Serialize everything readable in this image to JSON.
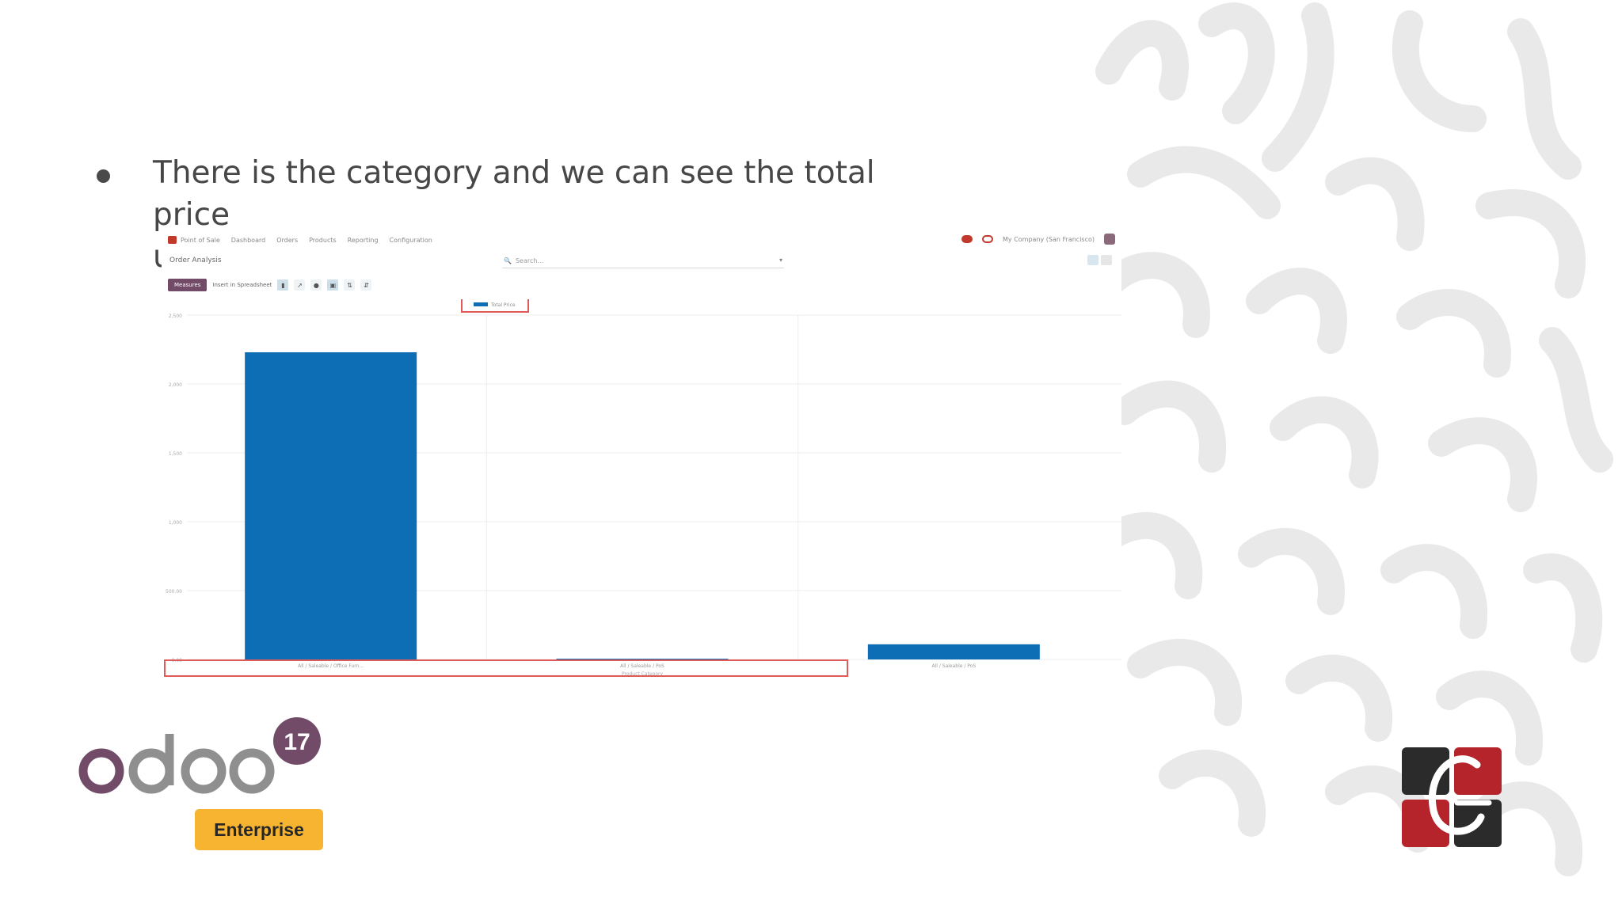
{
  "slide": {
    "bullet_text": "There is the category and we can see the total price\nunder the each category."
  },
  "app": {
    "menu": [
      "Point of Sale",
      "Dashboard",
      "Orders",
      "Products",
      "Reporting",
      "Configuration"
    ],
    "company": "My Company (San Francisco)",
    "breadcrumb": "Order Analysis",
    "search_placeholder": "Search...",
    "measures_label": "Measures",
    "insert_label": "Insert in Spreadsheet"
  },
  "chart_data": {
    "type": "bar",
    "series": [
      {
        "name": "Total Price",
        "values": [
          2230,
          0,
          110
        ]
      }
    ],
    "categories": [
      "All / Saleable / Office Furn...",
      "All / Saleable / PoS",
      "All / Saleable / PoS"
    ],
    "xlabel": "Product Category",
    "ylabel": "",
    "yticks": [
      "0.00",
      "500.00",
      "1,000",
      "1,500",
      "2,000",
      "2,500"
    ],
    "ylim": [
      0,
      2500
    ],
    "legend_position": "top-center",
    "colors": {
      "bar": "#0d6eb6",
      "highlight": "#e05a5a"
    }
  },
  "branding": {
    "odoo_text": "odoo",
    "version": "17",
    "edition": "Enterprise",
    "colors": {
      "odoo_purple": "#714b67",
      "odoo_gray": "#8f8f8f",
      "edition_bg": "#f7b431",
      "logo_red": "#b5232b",
      "logo_dark": "#2b2b2b"
    }
  }
}
